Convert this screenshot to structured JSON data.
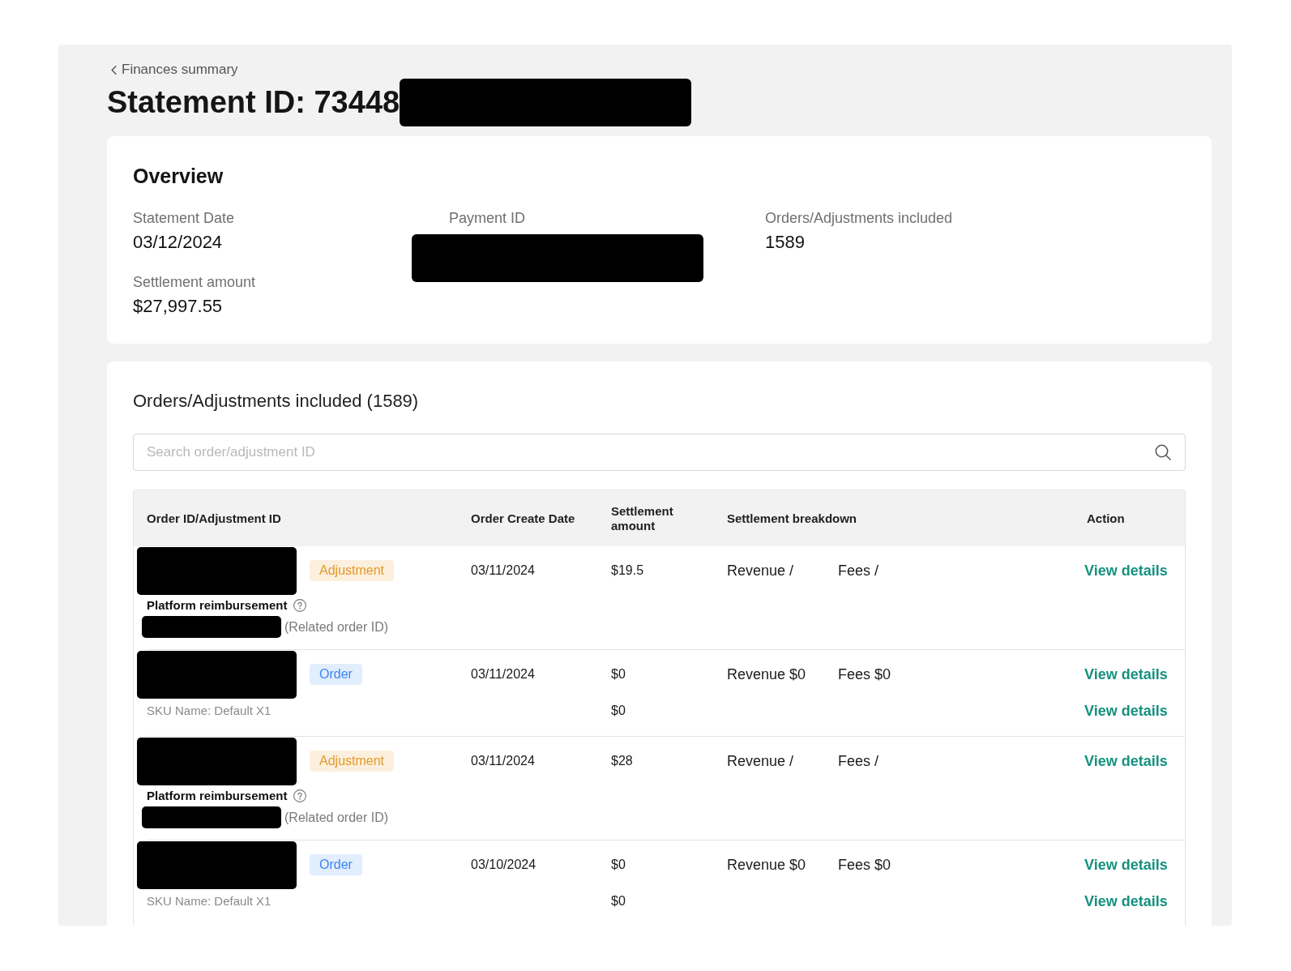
{
  "back_link": {
    "label": "Finances summary"
  },
  "page_title": {
    "text": "Statement ID: 73448",
    "redacted": true
  },
  "overview": {
    "title": "Overview",
    "columns": [
      {
        "fields": [
          {
            "label": "Statement Date",
            "value": "03/12/2024"
          },
          {
            "label": "Settlement amount",
            "value": "$27,997.55"
          }
        ]
      },
      {
        "fields": [
          {
            "label": "Payment ID",
            "redacted": true
          }
        ]
      },
      {
        "fields": [
          {
            "label": "Orders/Adjustments included",
            "value": "1589"
          }
        ]
      }
    ]
  },
  "orders": {
    "title": "Orders/Adjustments included (1589)",
    "search": {
      "placeholder": "Search order/adjustment ID"
    },
    "table": {
      "columns": [
        "Order ID/Adjustment ID",
        "Order Create Date",
        "Settlement amount",
        "Settlement breakdown",
        "Action"
      ],
      "rows": [
        {
          "kind": "adjustment",
          "id_redacted": true,
          "type_tag": "Adjustment",
          "reason": "Platform reimbursement",
          "related_order": {
            "redacted": true,
            "label": "(Related order ID)"
          },
          "create_date": "03/11/2024",
          "amounts": [
            "$19.5"
          ],
          "revenue": "Revenue /",
          "fees": "Fees /",
          "actions": [
            "View details"
          ]
        },
        {
          "kind": "order",
          "id_redacted": true,
          "type_tag": "Order",
          "sku": "SKU Name: Default X1",
          "create_date": "03/11/2024",
          "amounts": [
            "$0",
            "$0"
          ],
          "revenue": "Revenue $0",
          "fees": "Fees $0",
          "actions": [
            "View details",
            "View details"
          ]
        },
        {
          "kind": "adjustment",
          "id_redacted": true,
          "type_tag": "Adjustment",
          "reason": "Platform reimbursement",
          "related_order": {
            "redacted": true,
            "label": "(Related order ID)"
          },
          "create_date": "03/11/2024",
          "amounts": [
            "$28"
          ],
          "revenue": "Revenue /",
          "fees": "Fees /",
          "actions": [
            "View details"
          ]
        },
        {
          "kind": "order",
          "id_redacted": true,
          "type_tag": "Order",
          "sku": "SKU Name: Default X1",
          "create_date": "03/10/2024",
          "amounts": [
            "$0",
            "$0"
          ],
          "revenue": "Revenue $0",
          "fees": "Fees $0",
          "actions": [
            "View details",
            "View details"
          ]
        }
      ]
    }
  }
}
